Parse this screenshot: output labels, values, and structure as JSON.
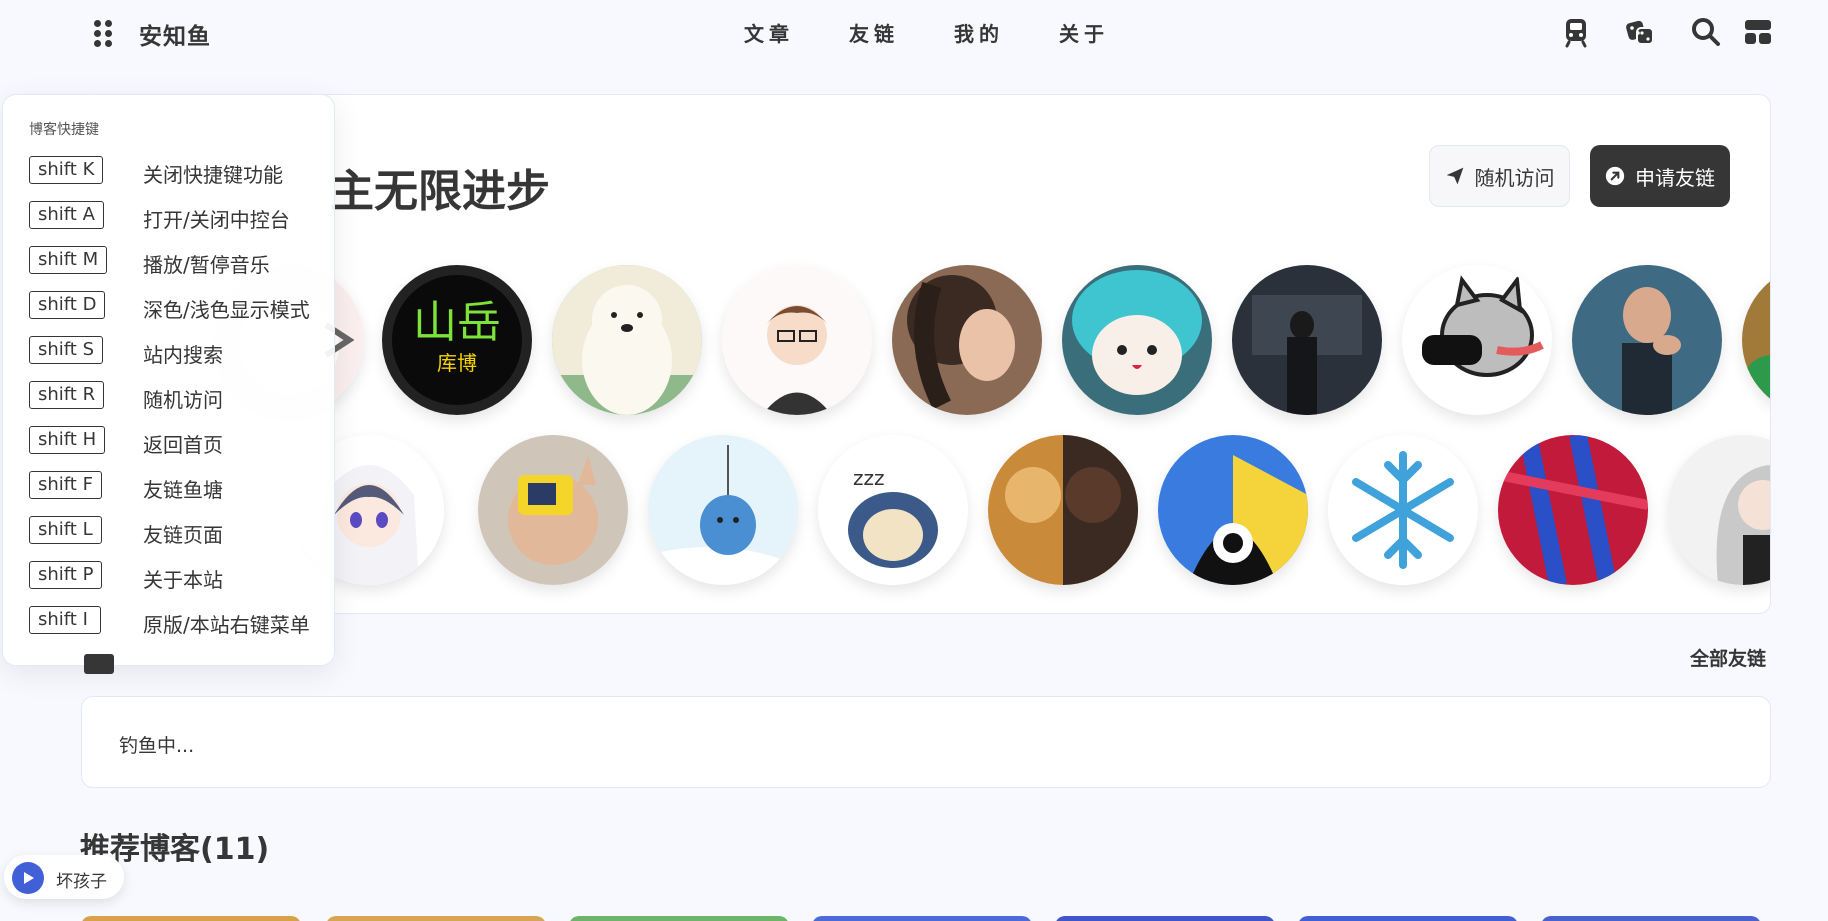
{
  "nav": {
    "site_name": "安知鱼",
    "links": [
      "文章",
      "友链",
      "我的",
      "关于"
    ],
    "right_icons": [
      "subway-icon",
      "dice-icon",
      "search-icon",
      "console-icon"
    ]
  },
  "links_card": {
    "title": "主无限进步",
    "random_button": "随机访问",
    "apply_button": "申请友链"
  },
  "shortcuts": {
    "title": "博客快捷键",
    "items": [
      {
        "key": "shift K",
        "label": "关闭快捷键功能"
      },
      {
        "key": "shift A",
        "label": "打开/关闭中控台"
      },
      {
        "key": "shift M",
        "label": "播放/暂停音乐"
      },
      {
        "key": "shift D",
        "label": "深色/浅色显示模式"
      },
      {
        "key": "shift S",
        "label": "站内搜索"
      },
      {
        "key": "shift R",
        "label": "随机访问"
      },
      {
        "key": "shift H",
        "label": "返回首页"
      },
      {
        "key": "shift F",
        "label": "友链鱼塘"
      },
      {
        "key": "shift L",
        "label": "友链页面"
      },
      {
        "key": "shift P",
        "label": "关于本站"
      },
      {
        "key": "shift I",
        "label": "原版/本站右键菜单"
      }
    ]
  },
  "moments": {
    "all_links": "全部友链",
    "fishing_text": "钓鱼中..."
  },
  "recommend": {
    "title": "推荐博客(11)"
  },
  "music": {
    "song": "坏孩子"
  },
  "avatars_row1": [
    "cat-avatar",
    "shanyue-avatar",
    "polar-bear-avatar",
    "anime-boy-avatar",
    "girl-photo-avatar",
    "miku-plush-avatar",
    "dark-photo-avatar",
    "dog-gamepad-avatar",
    "man-photo-avatar",
    "partial-avatar"
  ],
  "avatars_row2": [
    "anime-girl-avatar",
    "child-photo-avatar",
    "penguin-avatar",
    "snorlax-avatar",
    "cats-painting-avatar",
    "blue-eye-avatar",
    "snowflake-avatar",
    "red-fabric-avatar",
    "silver-hair-avatar"
  ],
  "colors": {
    "accent": "#4160d8",
    "text": "#363636",
    "background": "#f7f9fe"
  }
}
